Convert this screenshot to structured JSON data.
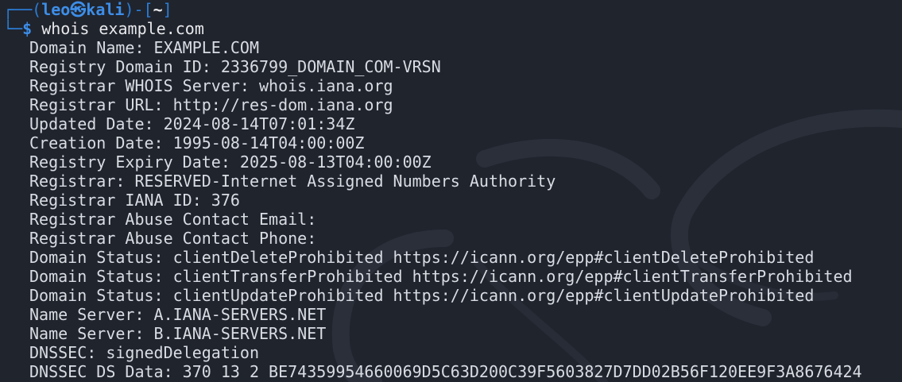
{
  "prompt": {
    "frame_open": "┌──(",
    "user": "leo",
    "separator_icon": "㉿",
    "host": "kali",
    "frame_mid": ")-[",
    "cwd": "~",
    "frame_close": "]",
    "frame_bottom": "└─",
    "symbol": "$",
    "command": "whois example.com"
  },
  "output_lines": [
    "Domain Name: EXAMPLE.COM",
    "Registry Domain ID: 2336799_DOMAIN_COM-VRSN",
    "Registrar WHOIS Server: whois.iana.org",
    "Registrar URL: http://res-dom.iana.org",
    "Updated Date: 2024-08-14T07:01:34Z",
    "Creation Date: 1995-08-14T04:00:00Z",
    "Registry Expiry Date: 2025-08-13T04:00:00Z",
    "Registrar: RESERVED-Internet Assigned Numbers Authority",
    "Registrar IANA ID: 376",
    "Registrar Abuse Contact Email:",
    "Registrar Abuse Contact Phone:",
    "Domain Status: clientDeleteProhibited https://icann.org/epp#clientDeleteProhibited",
    "Domain Status: clientTransferProhibited https://icann.org/epp#clientTransferProhibited",
    "Domain Status: clientUpdateProhibited https://icann.org/epp#clientUpdateProhibited",
    "Name Server: A.IANA-SERVERS.NET",
    "Name Server: B.IANA-SERVERS.NET",
    "DNSSEC: signedDelegation",
    "DNSSEC DS Data: 370 13 2 BE74359954660069D5C63D200C39F5603827D7DD02B56F120EE9F3A8676424"
  ],
  "colors": {
    "background": "#20242d",
    "prompt_accent": "#3d8ee8",
    "text": "#d9dce3"
  },
  "icons": {
    "wallpaper": "kali-dragon-watermark-icon"
  }
}
